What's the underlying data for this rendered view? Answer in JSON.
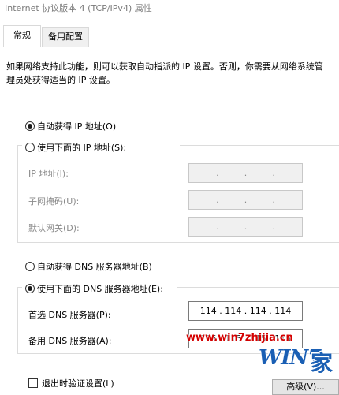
{
  "window": {
    "title": "Internet 协议版本 4 (TCP/IPv4) 属性"
  },
  "tabs": [
    {
      "label": "常规"
    },
    {
      "label": "备用配置"
    }
  ],
  "description": "如果网络支持此功能，则可以获取自动指派的 IP 设置。否则，你需要从网络系统管理员处获得适当的 IP 设置。",
  "ip": {
    "auto_label": "自动获得 IP 地址(O)",
    "manual_label": "使用下面的 IP 地址(S):",
    "auto_selected": true,
    "fields": [
      {
        "label": "IP 地址(I):",
        "value": ".     .     ."
      },
      {
        "label": "子网掩码(U):",
        "value": ".     .     ."
      },
      {
        "label": "默认网关(D):",
        "value": ".     .     ."
      }
    ]
  },
  "dns": {
    "auto_label": "自动获得 DNS 服务器地址(B)",
    "manual_label": "使用下面的 DNS 服务器地址(E):",
    "manual_selected": true,
    "preferred_label": "首选 DNS 服务器(P):",
    "preferred_value": "114 . 114 . 114 . 114",
    "alternate_label": "备用 DNS 服务器(A):",
    "alternate_value": "115 . 115 . 115 . 115"
  },
  "validate_on_exit_label": "退出时验证设置(L)",
  "validate_on_exit_checked": false,
  "advanced_button_label": "高级(V)...",
  "watermark": {
    "url": "www.win7zhijia.cn",
    "logo_text": "WIN7",
    "logo_char": "家"
  },
  "colors": {
    "watermark_red": "#d40000",
    "watermark_blue": "#1a5fb4"
  }
}
